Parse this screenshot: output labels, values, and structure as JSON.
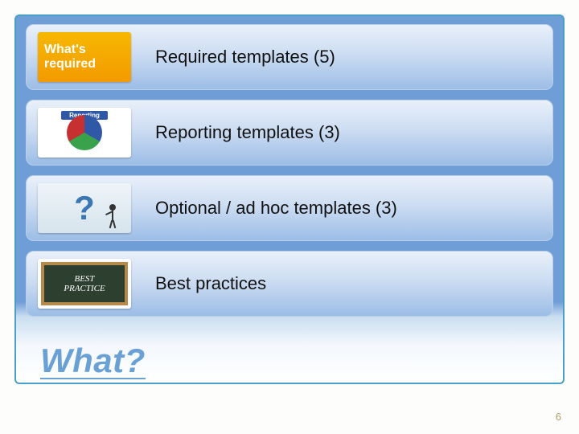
{
  "rows": [
    {
      "label": "Required templates (5)",
      "icon_top": "What's",
      "icon_bottom": "required"
    },
    {
      "label": "Reporting templates (3)",
      "icon_caption": "Reporting"
    },
    {
      "label": "Optional / ad hoc templates (3)"
    },
    {
      "label": "Best practices",
      "chalk_top": "BEST",
      "chalk_bottom": "PRACTICE"
    }
  ],
  "title": "What?",
  "page_number": "6"
}
